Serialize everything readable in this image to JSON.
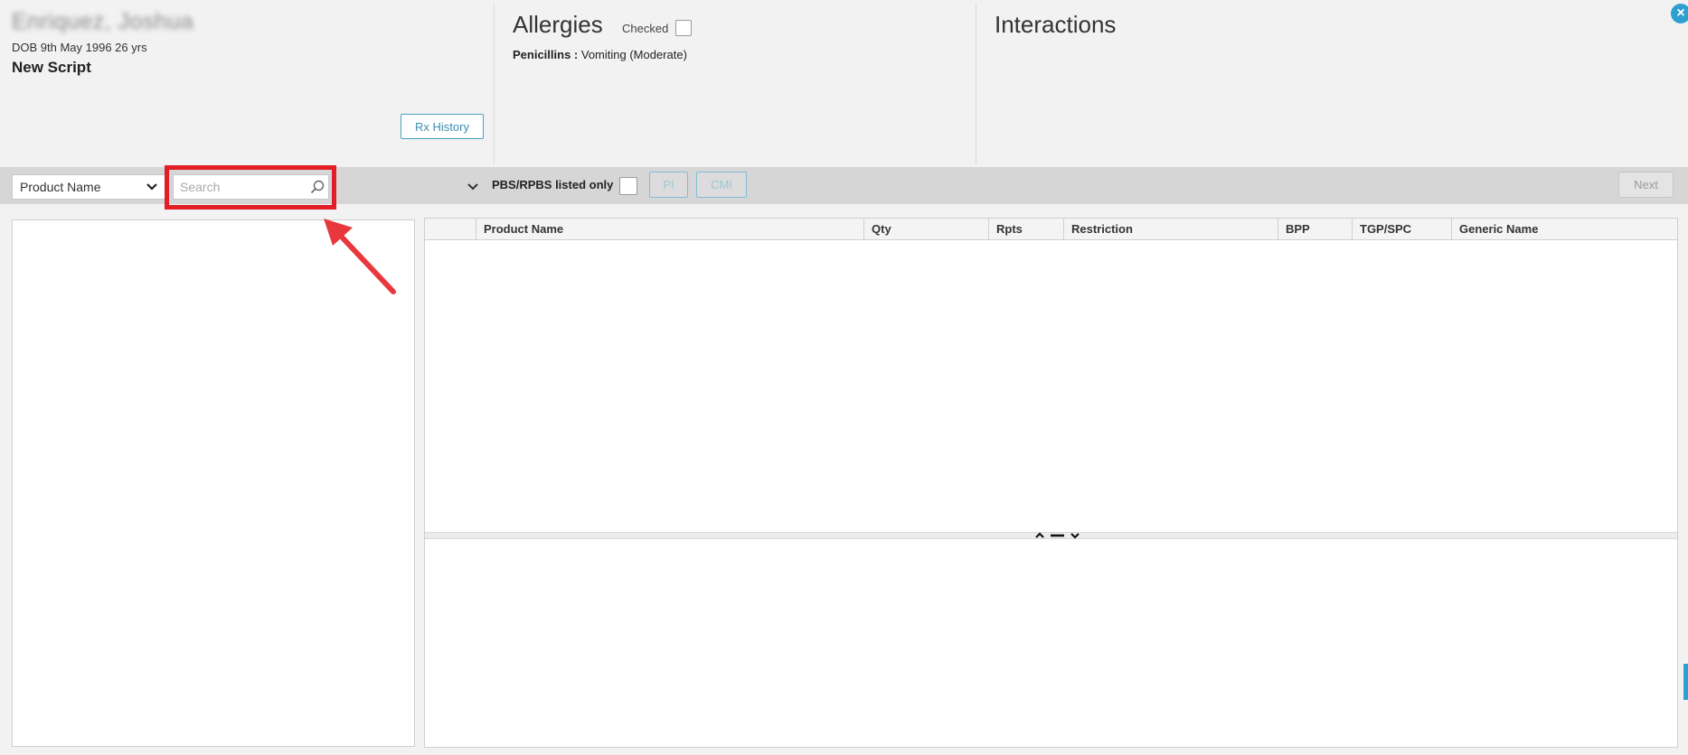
{
  "patient": {
    "name": "Enriquez, Joshua",
    "dob_line": "DOB 9th May 1996 26 yrs",
    "script_title": "New Script",
    "rx_history_label": "Rx History"
  },
  "allergies": {
    "title": "Allergies",
    "checked_label": "Checked",
    "items": [
      {
        "allergen": "Penicillins :",
        "reaction": " Vomiting (Moderate)"
      }
    ]
  },
  "interactions": {
    "title": "Interactions"
  },
  "toolbar": {
    "search_type_value": "Product Name",
    "search_placeholder": "Search",
    "pbs_label": "PBS/RPBS listed only",
    "pi_label": "PI",
    "cmi_label": "CMI",
    "next_label": "Next"
  },
  "grid": {
    "columns": [
      "Product Name",
      "Qty",
      "Rpts",
      "Restriction",
      "BPP",
      "TGP/SPC",
      "Generic Name"
    ]
  },
  "colors": {
    "highlight": "#e21f26",
    "accent": "#2e9fd1",
    "toolbar_bg": "#d6d6d6"
  }
}
